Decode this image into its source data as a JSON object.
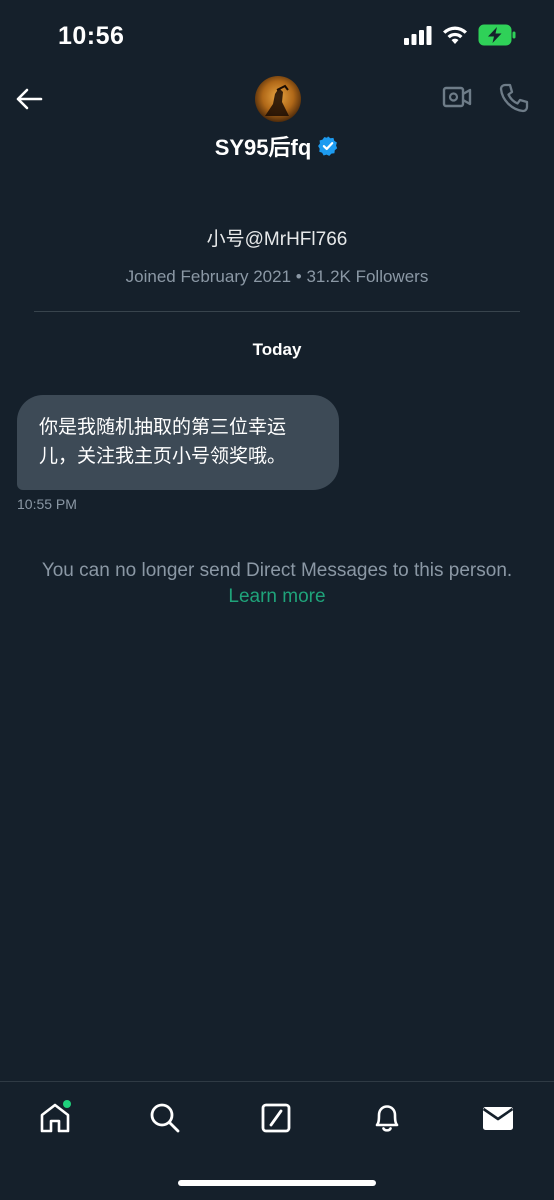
{
  "status_bar": {
    "time": "10:56"
  },
  "header": {
    "display_name": "SY95后fq",
    "verified": true,
    "back_icon": "arrow-left-icon",
    "video_icon": "video-camera-icon",
    "call_icon": "phone-icon"
  },
  "profile": {
    "handle": "小号@MrHFl766",
    "meta": "Joined February 2021 • 31.2K Followers"
  },
  "conversation": {
    "date_separator": "Today",
    "messages": [
      {
        "text_line1": "你是我随机抽取的第三位幸运",
        "text_line2": "儿，关注我主页小号领奖哦。",
        "time": "10:55 PM"
      }
    ],
    "notice": "You can no longer send Direct Messages to this person.",
    "learn_more": "Learn more"
  },
  "tabbar": {
    "items": [
      {
        "icon": "home-icon",
        "has_dot": true
      },
      {
        "icon": "search-icon"
      },
      {
        "icon": "grok-icon"
      },
      {
        "icon": "bell-icon"
      },
      {
        "icon": "envelope-icon"
      }
    ]
  },
  "colors": {
    "background": "#15202b",
    "bubble": "#3d4a56",
    "secondary_text": "#8b98a5",
    "accent_green": "#1fa37a",
    "verified_blue": "#1d9bf0"
  }
}
